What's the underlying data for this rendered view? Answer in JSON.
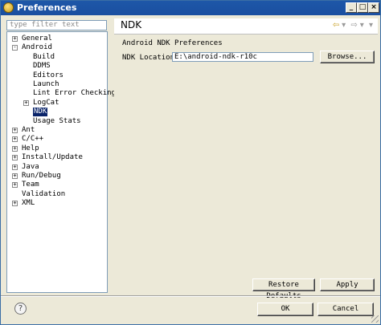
{
  "window": {
    "title": "Preferences"
  },
  "filter": {
    "placeholder": "type filter text"
  },
  "tree": [
    {
      "label": "General",
      "expander": "+"
    },
    {
      "label": "Android",
      "expander": "-"
    },
    {
      "label": "Build"
    },
    {
      "label": "DDMS"
    },
    {
      "label": "Editors"
    },
    {
      "label": "Launch"
    },
    {
      "label": "Lint Error Checking"
    },
    {
      "label": "LogCat",
      "expander": "+"
    },
    {
      "label": "NDK",
      "selected": true
    },
    {
      "label": "Usage Stats"
    },
    {
      "label": "Ant",
      "expander": "+"
    },
    {
      "label": "C/C++",
      "expander": "+"
    },
    {
      "label": "Help",
      "expander": "+"
    },
    {
      "label": "Install/Update",
      "expander": "+"
    },
    {
      "label": "Java",
      "expander": "+"
    },
    {
      "label": "Run/Debug",
      "expander": "+"
    },
    {
      "label": "Team",
      "expander": "+"
    },
    {
      "label": "Validation"
    },
    {
      "label": "XML",
      "expander": "+"
    }
  ],
  "page": {
    "title": "NDK",
    "description": "Android NDK Preferences",
    "ndk_location_label": "NDK Location",
    "ndk_location_value": "E:\\android-ndk-r10c",
    "browse_label": "Browse...",
    "restore_defaults_label": "Restore Defaults",
    "apply_label": "Apply"
  },
  "footer": {
    "ok_label": "OK",
    "cancel_label": "Cancel"
  }
}
